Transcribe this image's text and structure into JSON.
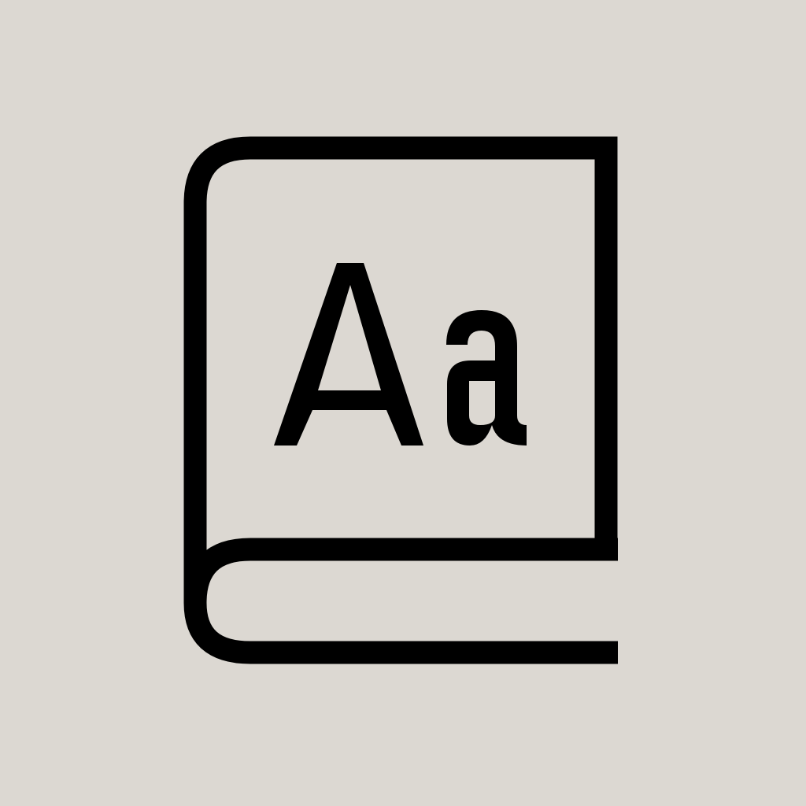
{
  "colors": {
    "background": "#dcd8d2",
    "stroke": "#000000"
  },
  "icon": {
    "name": "dictionary-book-icon",
    "glyph_text": "Aa"
  }
}
